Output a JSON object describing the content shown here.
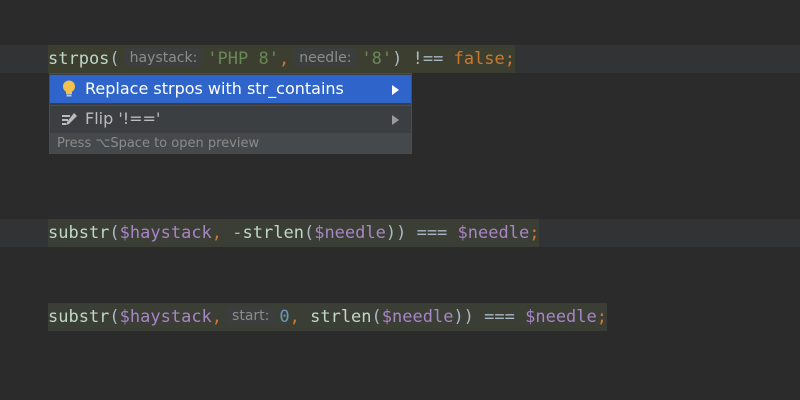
{
  "editor": {
    "line1": {
      "fn": "strpos",
      "open": "(",
      "hint1": "haystack:",
      "arg1": "'PHP 8'",
      "comma1": ",",
      "hint2": "needle:",
      "arg2": "'8'",
      "close": ")",
      "op": " !== ",
      "kw": "false",
      "semi": ";"
    },
    "line2": {
      "fn": "substr",
      "open": "(",
      "var1": "$haystack",
      "comma1": ", ",
      "neg": "-",
      "fn2": "strlen",
      "open2": "(",
      "var2": "$needle",
      "close2": "))",
      "op": " === ",
      "var3": "$needle",
      "semi": ";"
    },
    "line3": {
      "fn": "substr",
      "open": "(",
      "var1": "$haystack",
      "comma1": ",",
      "hint1": "start:",
      "num": "0",
      "comma2": ", ",
      "fn2": "strlen",
      "open2": "(",
      "var2": "$needle",
      "close2": "))",
      "op": " === ",
      "var3": "$needle",
      "semi": ";"
    }
  },
  "intention_popup": {
    "items": [
      {
        "label": "Replace strpos with str_contains",
        "icon": "lightbulb-icon",
        "selected": true
      },
      {
        "label": "Flip '!=='",
        "icon": "edit-pencil-icon",
        "selected": false
      }
    ],
    "footer": "Press ⌥Space to open preview"
  },
  "colors": {
    "background": "#2b2b2b",
    "selection": "#2f65ca",
    "string": "#6a8759",
    "keyword": "#cc7832",
    "variable": "#a785c6",
    "bulb": "#f2c14e"
  }
}
